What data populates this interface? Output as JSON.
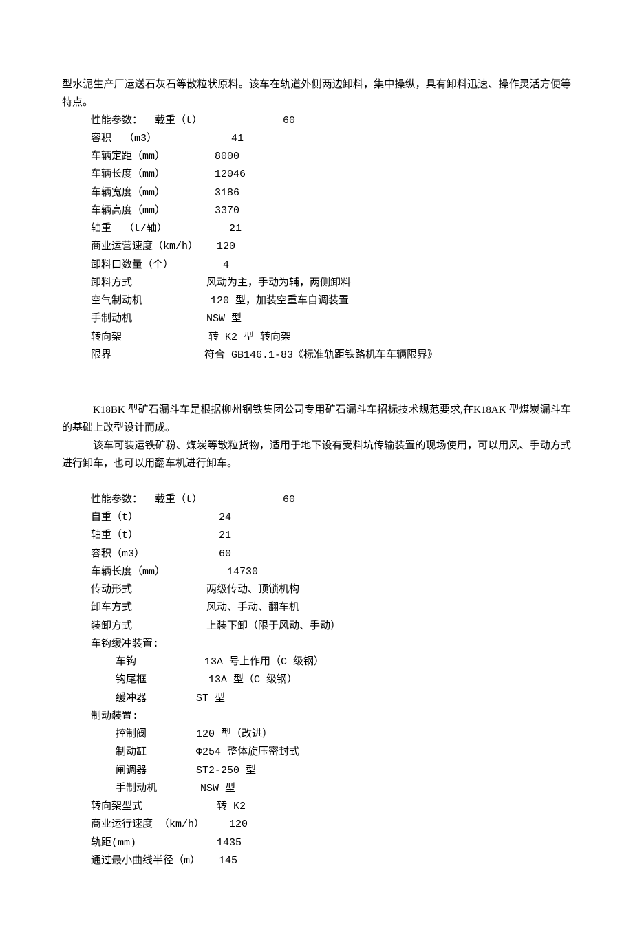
{
  "intro1a": "型水泥生产厂运送石灰石等散粒状原料。该车在轨道外侧两边卸料，集中操纵，具有卸料迅速、操作灵活方便等特点。",
  "spec1": [
    "性能参数：  载重（t）             60",
    "容积  （m3）            41",
    "车辆定距（mm）        8000",
    "车辆长度（mm）        12046",
    "车辆宽度（mm）        3186",
    "车辆高度（mm）        3370",
    "轴重  （t/轴）          21",
    "商业运营速度（km/h）   120",
    "卸料口数量（个）        4",
    "卸料方式            风动为主，手动为辅，两侧卸料",
    "空气制动机           120 型，加装空重车自调装置",
    "手制动机            NSW 型",
    "转向架              转 K2 型 转向架",
    "限界               符合 GB146.1-83《标准轨距铁路机车车辆限界》"
  ],
  "intro2a": "K18BK 型矿石漏斗车是根据柳州钢铁集团公司专用矿石漏斗车招标技术规范要求,在K18AK 型煤炭漏斗车的基础上改型设计而成。",
  "intro2b": "该车可装运铁矿粉、煤炭等散粒货物，适用于地下设有受料坑传输装置的现场使用，可以用风、手动方式进行卸车，也可以用翻车机进行卸车。",
  "spec2": [
    "性能参数：  载重（t）             60",
    "自重（t）             24",
    "轴重（t）             21",
    "容积（m3）            60",
    "车辆长度（mm）          14730",
    "传动形式            两级传动、顶锁机构",
    "卸车方式            风动、手动、翻车机",
    "装卸方式            上装下卸（限于风动、手动）",
    "车钩缓冲装置:",
    "    车钩           13A 号上作用（C 级钢）",
    "    钩尾框          13A 型（C 级钢）",
    "    缓冲器        ST 型",
    "制动装置:",
    "    控制阀        120 型（改进）",
    "    制动缸        Φ254 整体旋压密封式",
    "    闸调器        ST2-250 型",
    "    手制动机       NSW 型",
    "转向架型式            转 K2",
    "商业运行速度 （km/h）    120",
    "轨距(mm)             1435",
    "通过最小曲线半径（m）   145"
  ]
}
